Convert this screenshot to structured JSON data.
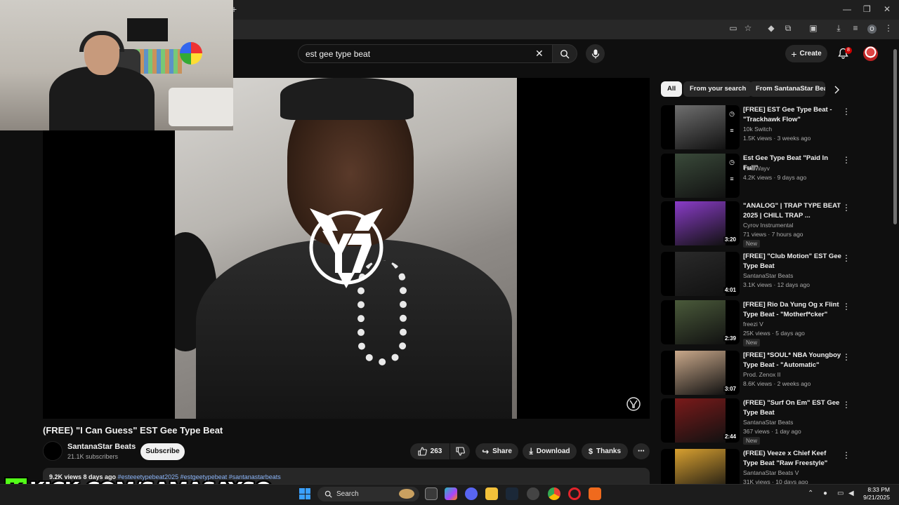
{
  "browser": {
    "new_tab": "+",
    "window_controls": [
      "—",
      "❐",
      "✕"
    ],
    "profile_letter": "O"
  },
  "search": {
    "query": "est gee type beat"
  },
  "masthead": {
    "create_label": "Create",
    "notification_count": "8"
  },
  "video": {
    "title": "(FREE) \"I Can Guess\" EST Gee Type Beat",
    "channel": "SantanaStar Beats",
    "subscribers": "21.1K subscribers",
    "subscribe_label": "Subscribe",
    "likes": "263",
    "share_label": "Share",
    "download_label": "Download",
    "thanks_label": "Thanks",
    "description_meta": "9.2K views  8 days ago",
    "description_tags": "#esteeetypebeat2025 #estgeetypebeat #santanastarbeats"
  },
  "chips": [
    "All",
    "From your search",
    "From SantanaStar Beats"
  ],
  "recommendations": [
    {
      "title": "[FREE] EST Gee Type Beat - \"Trackhawk Flow\"",
      "channel": "10k Switch",
      "meta": "1.5K views · 3 weeks ago",
      "duration": "",
      "badge": "",
      "thumb_color": "#6f6f6f"
    },
    {
      "title": "Est Gee Type Beat \"Paid In Full\"",
      "channel": "TmuWayv",
      "meta": "4.2K views · 9 days ago",
      "duration": "",
      "badge": "",
      "thumb_color": "#3a4a3a"
    },
    {
      "title": "\"ANALOG\" | TRAP TYPE BEAT 2025 | CHILL TRAP ...",
      "channel": "Cyrov Instrumental",
      "meta": "71 views · 7 hours ago",
      "duration": "3:20",
      "badge": "New",
      "thumb_color": "#8a3cc8"
    },
    {
      "title": "[FREE] \"Club Motion\" EST Gee Type Beat",
      "channel": "SantanaStar Beats",
      "meta": "3.1K views · 12 days ago",
      "duration": "4:01",
      "badge": "",
      "thumb_color": "#2a2a2a"
    },
    {
      "title": "[FREE] Rio Da Yung Og x Flint Type Beat - \"Motherf*cker\"",
      "channel": "freezi V",
      "meta": "25K views · 5 days ago",
      "duration": "2:39",
      "badge": "New",
      "thumb_color": "#4a5a3a"
    },
    {
      "title": "[FREE] *SOUL* NBA Youngboy Type Beat - \"Automatic\"",
      "channel": "Prod. Zenox II",
      "meta": "8.6K views · 2 weeks ago",
      "duration": "3:07",
      "badge": "",
      "thumb_color": "#c9a88a"
    },
    {
      "title": "(FREE) \"Surf On Em\" EST Gee Type Beat",
      "channel": "SantanaStar Beats",
      "meta": "367 views · 1 day ago",
      "duration": "2:44",
      "badge": "New",
      "thumb_color": "#7a1a1a"
    },
    {
      "title": "(FREE) Veeze x Chief Keef Type Beat \"Raw Freestyle\"",
      "channel": "SantanaStar Beats V",
      "meta": "31K views · 10 days ago",
      "duration": "",
      "badge": "",
      "thumb_color": "#d8a030"
    }
  ],
  "overlay": {
    "kick_letter": "K",
    "kick_url": "KICK.COM/SAMASAYSO"
  },
  "taskbar": {
    "search_label": "Search",
    "time": "8:33 PM",
    "date": "9/21/2025"
  },
  "colors": {
    "accent_red": "#cc0000",
    "kick_green": "#53fc18",
    "link_blue": "#8bb4f7"
  }
}
